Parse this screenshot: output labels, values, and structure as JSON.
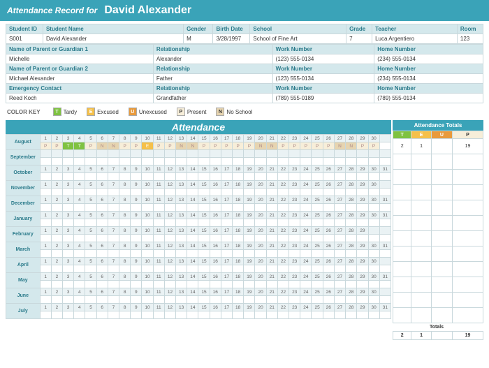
{
  "header": {
    "label": "Attendance Record for",
    "name": "David Alexander"
  },
  "student": {
    "cols": [
      "Student ID",
      "Student Name",
      "Gender",
      "Birth Date",
      "School",
      "Grade",
      "Teacher",
      "Room"
    ],
    "vals": [
      "S001",
      "David Alexander",
      "M",
      "3/28/1997",
      "School of Fine Art",
      "7",
      "Luca Argentiero",
      "123"
    ],
    "g1": {
      "h": [
        "Name of Parent or Guardian 1",
        "Relationship",
        "Work Number",
        "Home Number"
      ],
      "v": [
        "Michelle",
        "Alexander",
        "(123) 555-0134",
        "(234) 555-0134"
      ]
    },
    "g2": {
      "h": [
        "Name of Parent or Guardian 2",
        "Relationship",
        "Work Number",
        "Home Number"
      ],
      "v": [
        "Michael Alexander",
        "Father",
        "(123) 555-0134",
        "(234) 555-0134"
      ]
    },
    "ec": {
      "h": [
        "Emergency Contact",
        "Relationship",
        "Work Number",
        "Home Number"
      ],
      "v": [
        "Reed Koch",
        "Grandfather",
        "(789) 555-0189",
        "(789) 555-0134"
      ]
    }
  },
  "colorkey": {
    "label": "COLOR KEY",
    "items": [
      {
        "code": "T",
        "text": "Tardy",
        "cls": "sw-t"
      },
      {
        "code": "E",
        "text": "Excused",
        "cls": "sw-e"
      },
      {
        "code": "U",
        "text": "Unexcused",
        "cls": "sw-u"
      },
      {
        "code": "P",
        "text": "Present",
        "cls": "sw-p"
      },
      {
        "code": "N",
        "text": "No School",
        "cls": "sw-n"
      }
    ]
  },
  "attendance": {
    "title": "Attendance",
    "totals_header": "Attendance Totals",
    "tot_cols": [
      "T",
      "E",
      "U",
      "P"
    ],
    "months": [
      {
        "name": "August",
        "start": 1,
        "end": 30,
        "marks": [
          "P",
          "P",
          "T",
          "T",
          "P",
          "N",
          "N",
          "P",
          "P",
          "E",
          "P",
          "P",
          "N",
          "N",
          "P",
          "P",
          "P",
          "P",
          "P",
          "N",
          "N",
          "P",
          "P",
          "P",
          "P",
          "P",
          "N",
          "N",
          "P",
          "P"
        ],
        "totals": [
          "2",
          "1",
          "",
          "19"
        ]
      },
      {
        "name": "September",
        "start": null,
        "end": null,
        "marks": [],
        "totals": [
          "",
          "",
          "",
          ""
        ]
      },
      {
        "name": "October",
        "start": 1,
        "end": 31,
        "marks": [],
        "totals": [
          "",
          "",
          "",
          ""
        ]
      },
      {
        "name": "November",
        "start": 1,
        "end": 30,
        "marks": [],
        "totals": [
          "",
          "",
          "",
          ""
        ]
      },
      {
        "name": "December",
        "start": 1,
        "end": 31,
        "marks": [],
        "totals": [
          "",
          "",
          "",
          ""
        ]
      },
      {
        "name": "January",
        "start": 1,
        "end": 31,
        "marks": [],
        "totals": [
          "",
          "",
          "",
          ""
        ]
      },
      {
        "name": "February",
        "start": 1,
        "end": 29,
        "marks": [],
        "totals": [
          "",
          "",
          "",
          ""
        ]
      },
      {
        "name": "March",
        "start": 1,
        "end": 31,
        "marks": [],
        "totals": [
          "",
          "",
          "",
          ""
        ]
      },
      {
        "name": "April",
        "start": 1,
        "end": 30,
        "marks": [],
        "totals": [
          "",
          "",
          "",
          ""
        ]
      },
      {
        "name": "May",
        "start": 1,
        "end": 31,
        "marks": [],
        "totals": [
          "",
          "",
          "",
          ""
        ]
      },
      {
        "name": "June",
        "start": 1,
        "end": 30,
        "marks": [],
        "totals": [
          "",
          "",
          "",
          ""
        ]
      },
      {
        "name": "July",
        "start": 1,
        "end": 31,
        "marks": [],
        "totals": [
          "",
          "",
          "",
          ""
        ]
      }
    ],
    "grand_label": "Totals",
    "grand": [
      "2",
      "1",
      "",
      "19"
    ]
  }
}
